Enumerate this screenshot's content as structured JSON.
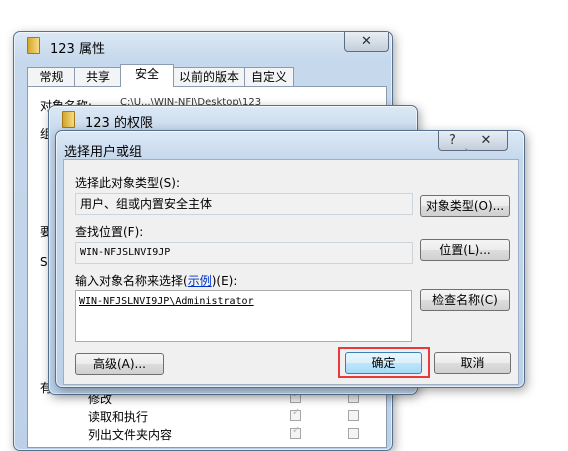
{
  "properties_window": {
    "title": "123 属性",
    "close_glyph": "✕",
    "tabs": [
      "常规",
      "共享",
      "安全",
      "以前的版本",
      "自定义"
    ],
    "object_name_label": "对象名称:",
    "object_name_value": "C:\\U...\\WIN-NFJ\\Desktop\\123",
    "fragments": [
      "组",
      "要",
      "S",
      "有"
    ],
    "permissions": [
      {
        "name": "修改",
        "allow": true,
        "deny": false
      },
      {
        "name": "读取和执行",
        "allow": true,
        "deny": false
      },
      {
        "name": "列出文件夹内容",
        "allow": true,
        "deny": false
      }
    ]
  },
  "permissions_window": {
    "title": "123 的权限"
  },
  "select_dialog": {
    "title": "选择用户或组",
    "help_glyph": "?",
    "close_glyph": "✕",
    "object_type_label": "选择此对象类型(S):",
    "object_type_value": "用户、组或内置安全主体",
    "object_type_button": "对象类型(O)...",
    "location_label": "查找位置(F):",
    "location_value": "WIN-NFJSLNVI9JP",
    "location_button": "位置(L)...",
    "enter_label_prefix": "输入对象名称来选择(",
    "enter_label_link": "示例",
    "enter_label_suffix": ")(E):",
    "names_value": "WIN-NFJSLNVI9JP\\Administrator",
    "check_names_button": "检查名称(C)",
    "advanced_button": "高级(A)...",
    "ok_button": "确定",
    "cancel_button": "取消"
  },
  "colors": {
    "highlight": "#e83a3a",
    "link": "#0033cc"
  }
}
